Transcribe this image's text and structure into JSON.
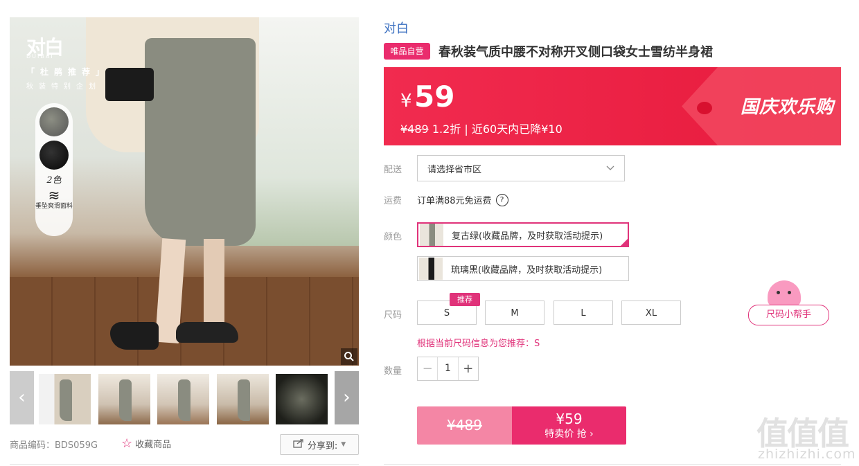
{
  "gallery": {
    "brand_logo": "对白",
    "brand_logo_sub": "DUIBAI",
    "recommend_text": "「杜鹃推荐」",
    "season_text": "秋装特别企划",
    "color_count": "2色",
    "fabric_label": "垂坠爽滑面料",
    "zoom_icon": "magnifier-icon",
    "thumbnails": [
      "thumb-1",
      "thumb-2",
      "thumb-3",
      "thumb-4",
      "thumb-5"
    ],
    "prev_glyph": "‹",
    "next_glyph": "›"
  },
  "footer": {
    "sku_label": "商品编码：BDS059G",
    "favorite_label": "收藏商品",
    "share_label": "分享到:"
  },
  "product": {
    "brand": "对白",
    "vip_badge": "唯品自营",
    "title": "春秋装气质中腰不对称开叉侧口袋女士雪纺半身裙"
  },
  "price": {
    "currency": "¥",
    "current": "59",
    "original": "¥489",
    "discount": "1.2折",
    "separator": "|",
    "drop_note": "近60天内已降¥10",
    "promo_label": "国庆欢乐购"
  },
  "delivery": {
    "label": "配送",
    "placeholder": "请选择省市区"
  },
  "freight": {
    "label": "运费",
    "text": "订单满88元免运费",
    "help_glyph": "?"
  },
  "colors": {
    "label": "颜色",
    "options": [
      {
        "name": "复古绿(收藏品牌，及时获取活动提示)",
        "selected": true
      },
      {
        "name": "琉璃黑(收藏品牌，及时获取活动提示)",
        "selected": false
      }
    ]
  },
  "sizes": {
    "label": "尺码",
    "options": [
      "S",
      "M",
      "L",
      "XL"
    ],
    "recommend_badge": "推荐",
    "helper_label": "尺码小帮手",
    "tip": "根据当前尺码信息为您推荐：S"
  },
  "quantity": {
    "label": "数量",
    "value": "1",
    "minus": "−",
    "plus": "+"
  },
  "buy": {
    "original_price": "¥489",
    "sale_price": "¥59",
    "action_label": "特卖价 抢 ›"
  },
  "watermark": {
    "logo": "值值值",
    "site": "zhizhizhi.com"
  },
  "colors_theme": {
    "accent": "#ea2c6d",
    "banner": "#e71a3c",
    "brand_link": "#3a6fc0"
  }
}
